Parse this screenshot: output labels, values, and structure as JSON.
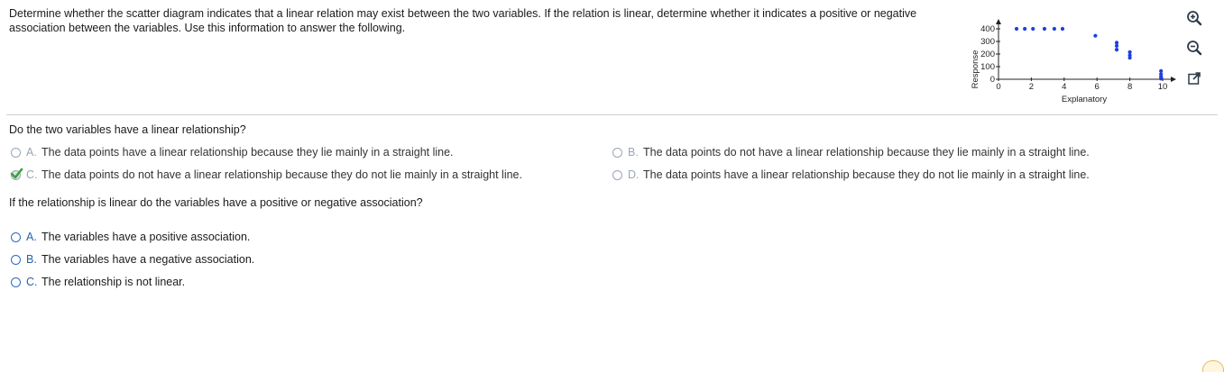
{
  "prompt": "Determine whether the scatter diagram indicates that a linear relation may exist between the two variables. If the relation is linear, determine whether it indicates a positive or negative association between the variables. Use this information to answer the following.",
  "chart_data": {
    "type": "scatter",
    "xlabel": "Explanatory",
    "ylabel": "Response",
    "xlim": [
      0,
      10
    ],
    "ylim": [
      0,
      400
    ],
    "x_ticks": [
      "0",
      "2",
      "4",
      "6",
      "8",
      "10"
    ],
    "y_ticks": [
      "0",
      "100",
      "200",
      "300",
      "400"
    ],
    "point_color": "#1f3fe0",
    "points": [
      {
        "x": 1.1,
        "y": 400
      },
      {
        "x": 1.6,
        "y": 400
      },
      {
        "x": 2.1,
        "y": 400
      },
      {
        "x": 2.8,
        "y": 400
      },
      {
        "x": 3.4,
        "y": 400
      },
      {
        "x": 3.9,
        "y": 400
      },
      {
        "x": 5.9,
        "y": 345
      },
      {
        "x": 7.2,
        "y": 290
      },
      {
        "x": 7.2,
        "y": 265
      },
      {
        "x": 7.2,
        "y": 235
      },
      {
        "x": 8.0,
        "y": 215
      },
      {
        "x": 8.0,
        "y": 190
      },
      {
        "x": 8.0,
        "y": 170
      },
      {
        "x": 9.9,
        "y": 65
      },
      {
        "x": 9.9,
        "y": 40
      },
      {
        "x": 9.9,
        "y": 20
      },
      {
        "x": 9.9,
        "y": 5
      }
    ]
  },
  "question1": {
    "text": "Do the two variables have a linear relationship?",
    "options": [
      {
        "letter": "A.",
        "text": "The data points have a linear relationship because they lie mainly in a straight line."
      },
      {
        "letter": "B.",
        "text": "The data points do not have a linear relationship because they lie mainly in a straight line."
      },
      {
        "letter": "C.",
        "text": "The data points do not have a linear relationship because they do not lie mainly in a straight line."
      },
      {
        "letter": "D.",
        "text": "The data points have a linear relationship because they do not lie mainly in a straight line."
      }
    ]
  },
  "question2": {
    "text": "If the relationship is linear do the variables have a positive or negative association?",
    "options": [
      {
        "letter": "A.",
        "text": "The variables have a positive association."
      },
      {
        "letter": "B.",
        "text": "The variables have a negative association."
      },
      {
        "letter": "C.",
        "text": "The relationship is not linear."
      }
    ]
  },
  "tools": [
    "zoom-in-icon",
    "zoom-out-icon",
    "popout-icon"
  ],
  "colors": {
    "accent": "#2a5ea8",
    "check": "#3aa33a",
    "muted": "#9aa6b5"
  }
}
